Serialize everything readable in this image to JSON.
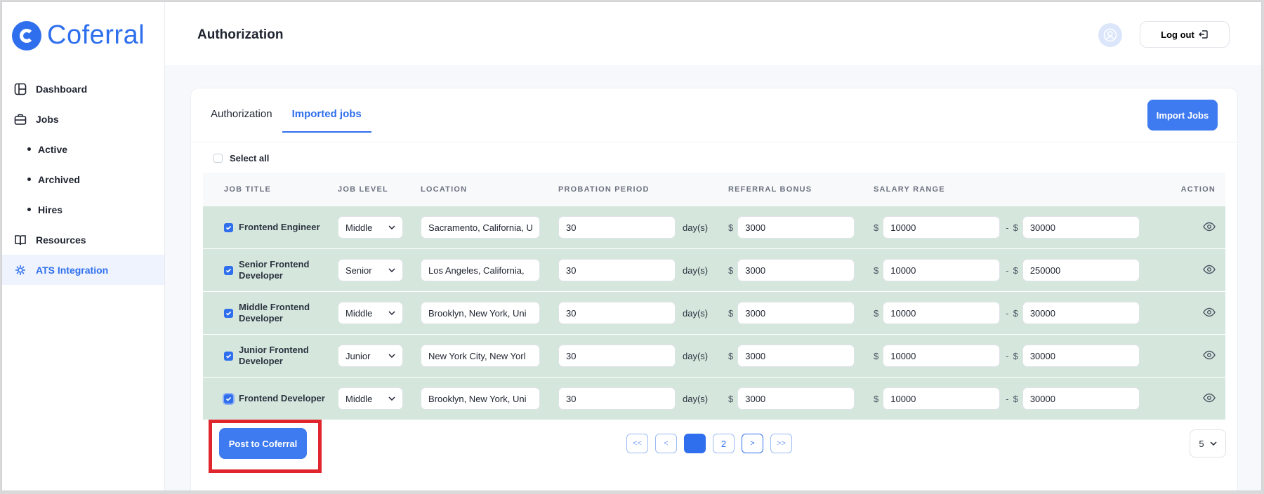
{
  "brand": {
    "name": "Coferral",
    "color": "#2f6fed"
  },
  "sidebar": {
    "items": [
      {
        "label": "Dashboard",
        "icon": "dashboard-icon"
      },
      {
        "label": "Jobs",
        "icon": "briefcase-icon"
      },
      {
        "label": "Active",
        "sub": true
      },
      {
        "label": "Archived",
        "sub": true
      },
      {
        "label": "Hires",
        "sub": true
      },
      {
        "label": "Resources",
        "icon": "book-icon"
      },
      {
        "label": "ATS Integration",
        "icon": "ats-integration-icon",
        "active": true
      }
    ]
  },
  "header": {
    "title": "Authorization",
    "logout_label": "Log out"
  },
  "tabs": [
    {
      "label": "Authorization",
      "active": false
    },
    {
      "label": "Imported jobs",
      "active": true
    }
  ],
  "import_button": "Import Jobs",
  "select_all_label": "Select all",
  "columns": {
    "job_title": "JOB TITLE",
    "job_level": "JOB LEVEL",
    "location": "LOCATION",
    "probation": "PROBATION PERIOD",
    "bonus": "REFERRAL BONUS",
    "salary": "SALARY RANGE",
    "action": "ACTION"
  },
  "units": {
    "days": "day(s)",
    "currency": "$",
    "range_sep": "-"
  },
  "rows": [
    {
      "title": "Frontend Engineer",
      "level": "Middle",
      "location": "Sacramento, California, U",
      "probation": "30",
      "bonus": "3000",
      "salary_min": "10000",
      "salary_max": "30000",
      "checked": true
    },
    {
      "title": "Senior Frontend Developer",
      "level": "Senior",
      "location": "Los Angeles, California,",
      "probation": "30",
      "bonus": "3000",
      "salary_min": "10000",
      "salary_max": "250000",
      "checked": true
    },
    {
      "title": "Middle Frontend Developer",
      "level": "Middle",
      "location": "Brooklyn, New York, Uni",
      "probation": "30",
      "bonus": "3000",
      "salary_min": "10000",
      "salary_max": "30000",
      "checked": true
    },
    {
      "title": "Junior Frontend Developer",
      "level": "Junior",
      "location": "New York City, New Yorl",
      "probation": "30",
      "bonus": "3000",
      "salary_min": "10000",
      "salary_max": "30000",
      "checked": true
    },
    {
      "title": "Frontend Developer",
      "level": "Middle",
      "location": "Brooklyn, New York, Uni",
      "probation": "30",
      "bonus": "3000",
      "salary_min": "10000",
      "salary_max": "30000",
      "checked": true
    }
  ],
  "post_button": "Post to Coferral",
  "pagination": {
    "first": "<<",
    "prev": "<",
    "pages": [
      "1",
      "2"
    ],
    "current": "1",
    "next": ">",
    "last": ">>"
  },
  "per_page": "5",
  "row_highlight_color": "#d5e7dd",
  "highlight_box_color": "#e0262c"
}
